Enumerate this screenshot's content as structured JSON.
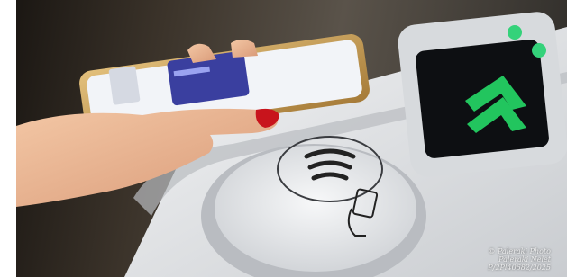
{
  "photo": {
    "subject": "contactless-payment-at-transit-turnstile",
    "icons": [
      "contactless-symbol-icon",
      "tap-card-hand-icon",
      "double-chevron-up-arrow-icon",
      "green-status-light-icon"
    ],
    "colors": {
      "chevron": "#22c55e",
      "status_light": "#34d27a",
      "screen": "#0d0f12",
      "phone_frame": "#c59a55",
      "card": "#3a3f9f",
      "nail_polish": "#c8141c",
      "turnstile": "#e9ebee"
    }
  },
  "watermark": {
    "line1": "© Paleraki Photo",
    "line2": "Paleraki Nelet",
    "line3": "P/2Pl40682/2025"
  }
}
